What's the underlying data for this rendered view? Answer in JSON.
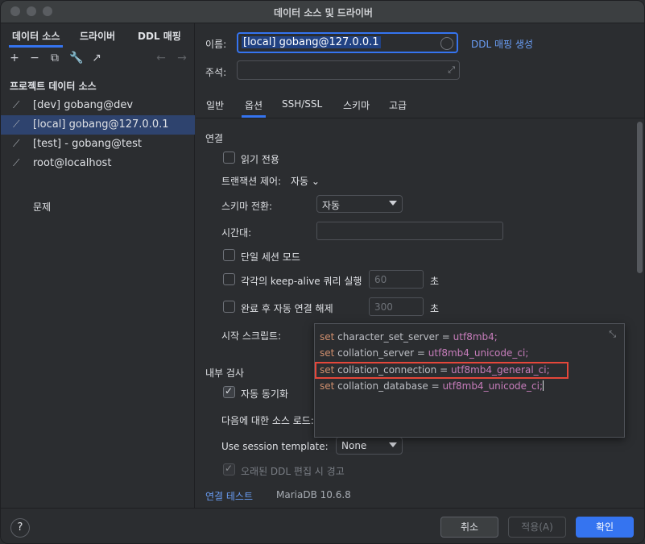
{
  "window": {
    "title": "데이터 소스 및 드라이버"
  },
  "left": {
    "tabs": [
      "데이터 소스",
      "드라이버",
      "DDL 매핑"
    ],
    "section_title": "프로젝트 데이터 소스",
    "datasources": [
      {
        "label": "[dev] gobang@dev",
        "selected": false
      },
      {
        "label": "[local] gobang@127.0.0.1",
        "selected": true
      },
      {
        "label": "[test] - gobang@test",
        "selected": false
      },
      {
        "label": "root@localhost",
        "selected": false
      }
    ],
    "problems": "문제"
  },
  "right": {
    "name_label": "이름:",
    "name_value": "[local] gobang@127.0.0.1",
    "ddl_link": "DDL 매핑 생성",
    "comment_label": "주석:",
    "comment_value": "",
    "tabs": [
      "일반",
      "옵션",
      "SSH/SSL",
      "스키마",
      "고급"
    ],
    "active_tab": "옵션",
    "connection": {
      "heading": "연결",
      "read_only": {
        "label": "읽기 전용",
        "checked": false
      },
      "tx_control": {
        "label": "트랜잭션 제어:",
        "value": "자동"
      },
      "schema_switch": {
        "label": "스키마 전환:",
        "value": "자동"
      },
      "timezone": {
        "label": "시간대:",
        "value": ""
      },
      "single_session": {
        "label": "단일 세션 모드",
        "checked": false
      },
      "keepalive": {
        "label": "각각의 keep-alive 쿼리 실행",
        "checked": false,
        "value": "60",
        "unit": "초"
      },
      "auto_disconnect": {
        "label": "완료 후 자동 연결 해제",
        "checked": false,
        "value": "300",
        "unit": "초"
      },
      "startup_script_label": "시작 스크립트:"
    },
    "script_lines": [
      {
        "kw": "set",
        "name": "character_set_server",
        "eq": " = ",
        "val": "utf8mb4;"
      },
      {
        "kw": "set",
        "name": "collation_server",
        "eq": " = ",
        "val": "utf8mb4_unicode_ci;"
      },
      {
        "kw": "set",
        "name": "collation_connection",
        "eq": " = ",
        "val": "utf8mb4_general_ci;"
      },
      {
        "kw": "set",
        "name": "collation_database",
        "eq": " = ",
        "val": "utf8mb4_unicode_ci;"
      }
    ],
    "introspection": {
      "heading": "내부 검사",
      "auto_sync": {
        "label": "자동 동기화",
        "checked": true
      },
      "load_sources_label": "다음에 대한 소스 로드:",
      "session_template": {
        "label": "Use session template:",
        "value": "None"
      },
      "ddl_warning": {
        "label": "오래된 DDL 편집 시 경고",
        "checked": true
      }
    },
    "test_link": "연결 테스트",
    "db_version": "MariaDB 10.6.8"
  },
  "footer": {
    "help": "?",
    "cancel": "취소",
    "apply": "적용(A)",
    "ok": "확인"
  }
}
